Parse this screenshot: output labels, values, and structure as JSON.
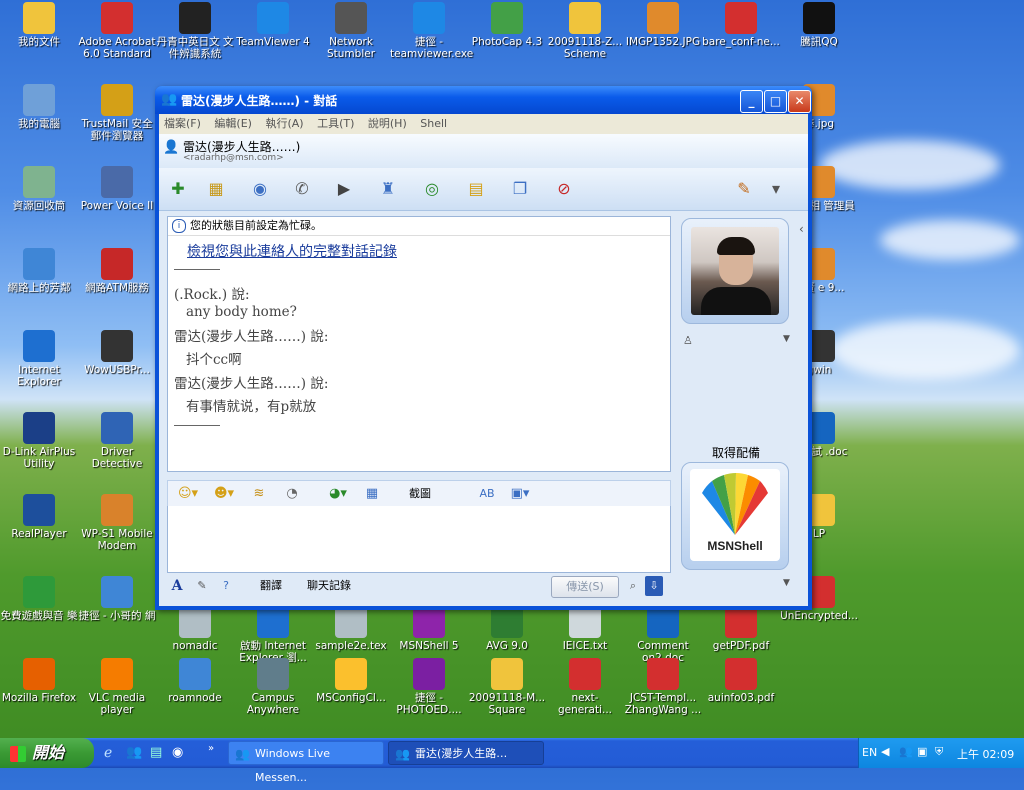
{
  "desktop": {
    "icons": [
      {
        "label": "我的文件",
        "icon": "folder-icon",
        "color": "#f0c43c"
      },
      {
        "label": "Adobe Acrobat 6.0 Standard",
        "icon": "acrobat-icon",
        "color": "#d32f2f"
      },
      {
        "label": "丹青中英日文 文件辨識系統",
        "icon": "max-reader-icon",
        "color": "#222222"
      },
      {
        "label": "TeamViewer 4",
        "icon": "teamviewer-icon",
        "color": "#1e88e5"
      },
      {
        "label": "Network Stumbler",
        "icon": "antenna-icon",
        "color": "#555555"
      },
      {
        "label": "捷徑 - teamviewer.exe",
        "icon": "teamviewer-icon",
        "color": "#1e88e5"
      },
      {
        "label": "PhotoCap 4.3",
        "icon": "photocap-icon",
        "color": "#43a047"
      },
      {
        "label": "20091118-Z... Scheme",
        "icon": "folder-icon",
        "color": "#f0c43c"
      },
      {
        "label": "IMGP1352.JPG",
        "icon": "jpg-icon",
        "color": "#e08a2c"
      },
      {
        "label": "bare_conf-ne...",
        "icon": "pdf-icon",
        "color": "#d32f2f"
      },
      {
        "label": "騰訊QQ",
        "icon": "qq-penguin-icon",
        "color": "#111111"
      },
      {
        "label": "我的電腦",
        "icon": "computer-icon",
        "color": "#6fa0d8"
      },
      {
        "label": "TrustMail 安全 郵件瀏覽器",
        "icon": "trustmail-icon",
        "color": "#d4a017"
      },
      {
        "label": "資源回收筒",
        "icon": "recycle-bin-icon",
        "color": "#7fb38f"
      },
      {
        "label": "Power Voice II",
        "icon": "speaker-icon",
        "color": "#4a6aa8"
      },
      {
        "label": "網路上的芳鄰",
        "icon": "network-icon",
        "color": "#3f86d6"
      },
      {
        "label": "網路ATM服務",
        "icon": "atm-icon",
        "color": "#c62828"
      },
      {
        "label": "Internet Explorer",
        "icon": "ie-icon",
        "color": "#1e6fd0"
      },
      {
        "label": "WowUSBPr...",
        "icon": "usb-icon",
        "color": "#333333"
      },
      {
        "label": "D-Link AirPlus Utility",
        "icon": "dlink-icon",
        "color": "#1b3f87"
      },
      {
        "label": "Driver Detective",
        "icon": "window-icon",
        "color": "#2f64b5"
      },
      {
        "label": "RealPlayer",
        "icon": "realplayer-icon",
        "color": "#1d4f9c"
      },
      {
        "label": "WP-S1 Mobile Modem",
        "icon": "modem-icon",
        "color": "#d9822b"
      },
      {
        "label": "免費遊戲與音 樂",
        "icon": "gift-icon",
        "color": "#2e9a3a"
      },
      {
        "label": "捷徑 - 小哥的 網",
        "icon": "network-drive-icon",
        "color": "#3f86d6"
      },
      {
        "label": "nomadic",
        "icon": "file-icon",
        "color": "#b0bec5"
      },
      {
        "label": "啟動 Internet Explorer 瀏...",
        "icon": "ie-icon",
        "color": "#1e6fd0"
      },
      {
        "label": "sample2e.tex",
        "icon": "file-icon",
        "color": "#b0bec5"
      },
      {
        "label": "MSNShell 5",
        "icon": "msnshell-icon",
        "color": "#8e24aa"
      },
      {
        "label": "AVG 9.0",
        "icon": "avg-icon",
        "color": "#2e7d32"
      },
      {
        "label": "IEICE.txt",
        "icon": "txt-icon",
        "color": "#cfd8dc"
      },
      {
        "label": "Comment on2.doc",
        "icon": "doc-icon",
        "color": "#1565c0"
      },
      {
        "label": "getPDF.pdf",
        "icon": "pdf-icon",
        "color": "#d32f2f"
      },
      {
        "label": "UnEncrypted...",
        "icon": "pdf-icon",
        "color": "#d32f2f"
      },
      {
        "label": "Mozilla Firefox",
        "icon": "firefox-icon",
        "color": "#e66000"
      },
      {
        "label": "VLC media player",
        "icon": "vlc-cone-icon",
        "color": "#f57c00"
      },
      {
        "label": "roamnode",
        "icon": "network-icon",
        "color": "#3f86d6"
      },
      {
        "label": "Campus Anywhere",
        "icon": "computers-icon",
        "color": "#607d8b"
      },
      {
        "label": "MSConfigCl...",
        "icon": "broom-icon",
        "color": "#fbc02d"
      },
      {
        "label": "捷徑 - PHOTOED....",
        "icon": "photoed-icon",
        "color": "#7b1fa2"
      },
      {
        "label": "20091118-M... Square",
        "icon": "folder-icon",
        "color": "#f0c43c"
      },
      {
        "label": "next-generati...",
        "icon": "pdf-icon",
        "color": "#d32f2f"
      },
      {
        "label": "JCST-Templ... ZhangWang ...",
        "icon": "pdf-icon",
        "color": "#d32f2f"
      },
      {
        "label": "auinfo03.pdf",
        "icon": "pdf-icon",
        "color": "#d32f2f"
      },
      {
        "label": "棒.jpg",
        "icon": "jpg-icon",
        "color": "#e08a2c"
      },
      {
        "label": "ee 9 相 管理員",
        "icon": "camera-icon",
        "color": "#e08a2c"
      },
      {
        "label": "勝賢 e 9...",
        "icon": "app-icon",
        "color": "#e08a2c"
      },
      {
        "label": "gwin",
        "icon": "cable-icon",
        "color": "#333333"
      },
      {
        "label": "題測試 .doc",
        "icon": "doc-icon",
        "color": "#1565c0"
      },
      {
        "label": "LP",
        "icon": "folder-icon",
        "color": "#f0c43c"
      }
    ]
  },
  "window": {
    "title": "雷达(漫步人生路……) - 對話",
    "minimize": "_",
    "maximize": "□",
    "close": "✕",
    "menu": [
      "檔案(F)",
      "編輯(E)",
      "執行(A)",
      "工具(T)",
      "說明(H)",
      "Shell"
    ],
    "contact": {
      "name": "雷达(漫步人生路……)",
      "email": "<radarhp@msn.com>"
    },
    "toolbar_icons": [
      "invite-contact-icon",
      "send-files-icon",
      "webcam-icon",
      "call-icon",
      "video-icon",
      "remote-assistance-icon",
      "games-icon",
      "share-folder-icon",
      "activities-icon",
      "block-icon",
      "paint-brush-icon",
      "options-icon"
    ],
    "conversation": {
      "status_text": "您的狀態目前設定為忙碌。",
      "history_link": "檢視您與此連絡人的完整對話記錄",
      "messages": [
        {
          "sender": "(.Rock.) 說:",
          "text": "any body home?"
        },
        {
          "sender": "雷达(漫步人生路……)  說:",
          "text": "抖个cc啊"
        },
        {
          "sender": "雷达(漫步人生路……)  說:",
          "text": "有事情就说，有p就放"
        }
      ]
    },
    "edit_toolbar": {
      "emoticon_icon": "emoticon-icon",
      "wink_icon": "wink-icon",
      "nudge_icon": "nudge-icon",
      "voice_clip_icon": "voice-clip-icon",
      "background_icon": "background-icon",
      "grid_icon": "grid-icon",
      "screenshot_label": "截圖",
      "translate_icon": "translate-icon",
      "send_file_icon": "send-file-icon"
    },
    "bottom": {
      "font_label": "A",
      "handwriting_icon": "pen-icon",
      "help_icon": "help-icon",
      "translate_label": "翻譯",
      "history_label": "聊天記錄",
      "send_label": "傳送(S)",
      "search_icon": "search-icon",
      "download_icon": "download-icon"
    },
    "right_pane": {
      "get_accessories": "取得配備",
      "msnshell_logo": "MSNShell"
    }
  },
  "taskbar": {
    "start_label": "開始",
    "quicklaunch": [
      "ie-icon",
      "msn-icon",
      "folder-icon",
      "firefox-icon"
    ],
    "tasks": [
      {
        "label": "Windows Live Messen...",
        "icon": "msn-icon"
      },
      {
        "label": "雷达(漫步人生路…",
        "icon": "msn-icon"
      }
    ],
    "tray": {
      "lang": "EN",
      "clock": "上午 02:09"
    }
  },
  "colors": {
    "accent": "#0a52d8",
    "start_green": "#3a9a34"
  }
}
